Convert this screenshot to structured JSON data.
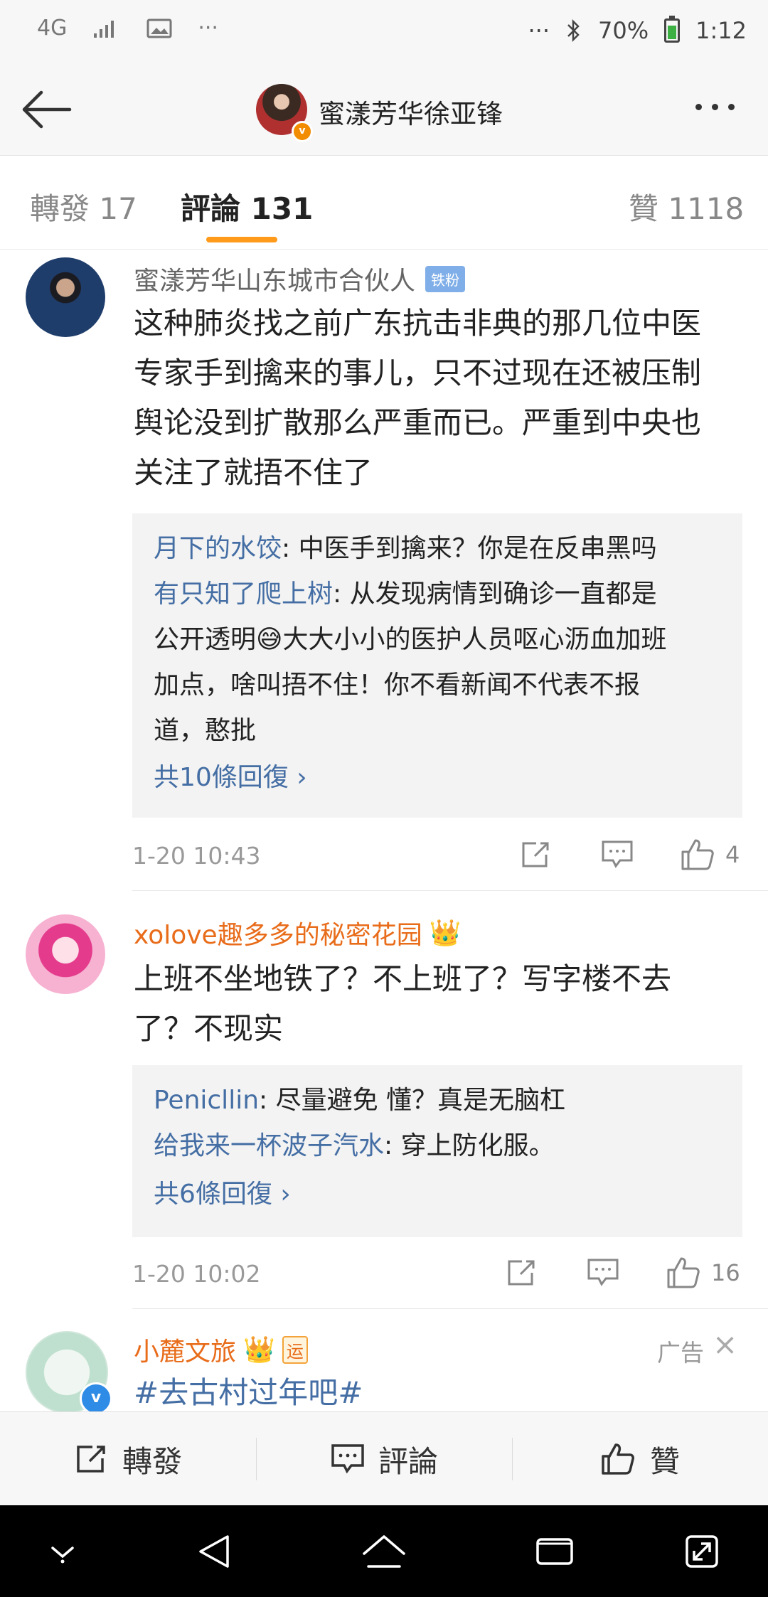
{
  "status_bar": {
    "network": "4G",
    "battery": "70%",
    "time": "1:12",
    "overflow_left": "···",
    "overflow_right": "···"
  },
  "header": {
    "title": "蜜漾芳华徐亚锋",
    "verified_mark": "v"
  },
  "tabs": {
    "repost": "轉發 17",
    "comments": "評論 131",
    "likes": "贊 1118"
  },
  "comments": [
    {
      "user": "蜜漾芳华山东城市合伙人",
      "badge": "铁粉",
      "lines": [
        "这种肺炎找之前广东抗击非典的那几位中医",
        "专家手到擒来的事儿，只不过现在还被压制",
        "舆论没到扩散那么严重而已。严重到中央也",
        "关注了就捂不住了"
      ],
      "replies": [
        {
          "user": "月下的水饺",
          "text": ": 中医手到擒来？你是在反串黑吗"
        },
        {
          "user": "有只知了爬上树",
          "text": ": 从发现病情到确诊一直都是"
        }
      ],
      "reply_continuation": [
        "公开透明😅大大小小的医护人员呕心沥血加班",
        "加点，啥叫捂不住！你不看新闻不代表不报",
        "道，憨批"
      ],
      "more_replies": "共10條回復 ›",
      "time": "1-20 10:43",
      "like_count": "4"
    },
    {
      "user": "xolove趣多多的秘密花园",
      "crown": "👑",
      "lines": [
        "上班不坐地铁了？不上班了？写字楼不去",
        "了？不现实"
      ],
      "replies": [
        {
          "user": "Penicllin",
          "text": ": 尽量避免  懂？真是无脑杠"
        },
        {
          "user": "给我来一杯波子汽水",
          "text": ": 穿上防化服。"
        }
      ],
      "more_replies": "共6條回復 ›",
      "time": "1-20 10:02",
      "like_count": "16"
    },
    {
      "user": "小麓文旅",
      "crown": "👑",
      "tag": "运",
      "ad_label": "广告",
      "ad_close": "×",
      "text": "#去古村过年吧#",
      "verified_mark": "v"
    }
  ],
  "bottom_bar": {
    "repost": "轉發",
    "comment": "評論",
    "like": "贊"
  },
  "colors": {
    "accent_orange": "#ff9a1a",
    "link_blue": "#446ea4",
    "vip_name": "#e86c1a"
  }
}
